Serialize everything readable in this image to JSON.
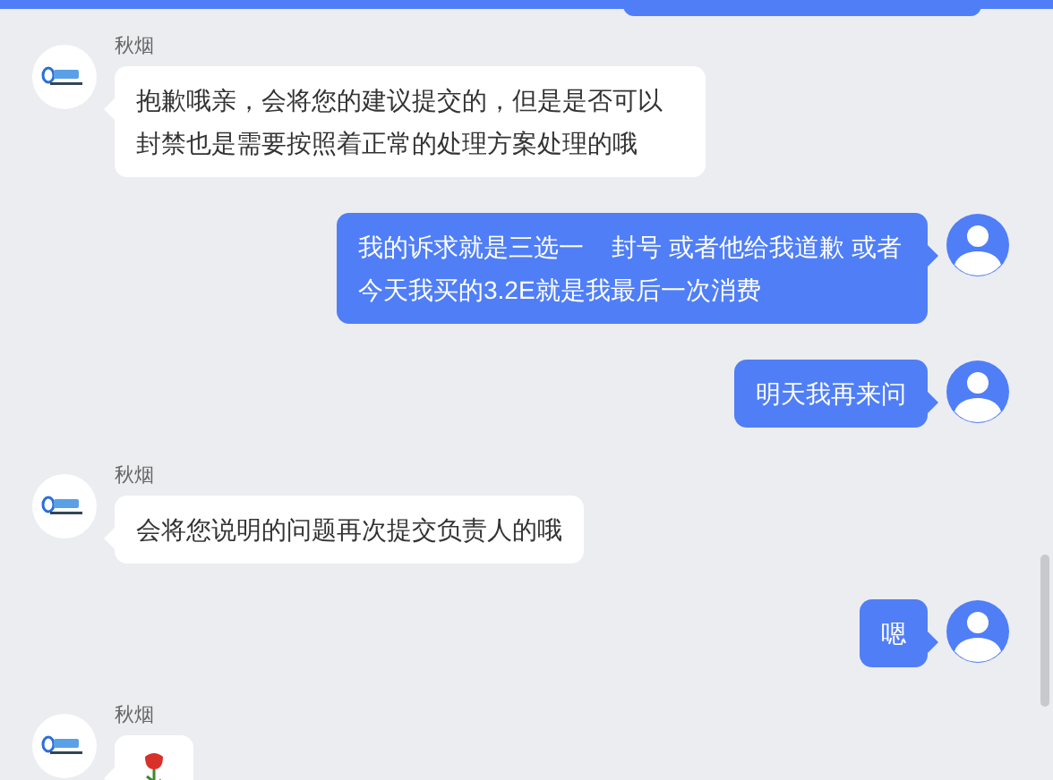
{
  "messages": [
    {
      "kind": "agent",
      "sender": "秋烟",
      "text": "抱歉哦亲，会将您的建议提交的，但是是否可以封禁也是需要按照着正常的处理方案处理的哦"
    },
    {
      "kind": "user",
      "text": "我的诉求就是三选一    封号 或者他给我道歉 或者今天我买的3.2E就是我最后一次消费"
    },
    {
      "kind": "user",
      "text": "明天我再来问"
    },
    {
      "kind": "agent",
      "sender": "秋烟",
      "text": "会将您说明的问题再次提交负责人的哦"
    },
    {
      "kind": "user",
      "text": "嗯"
    },
    {
      "kind": "agent-sticker",
      "sender": "秋烟"
    }
  ]
}
